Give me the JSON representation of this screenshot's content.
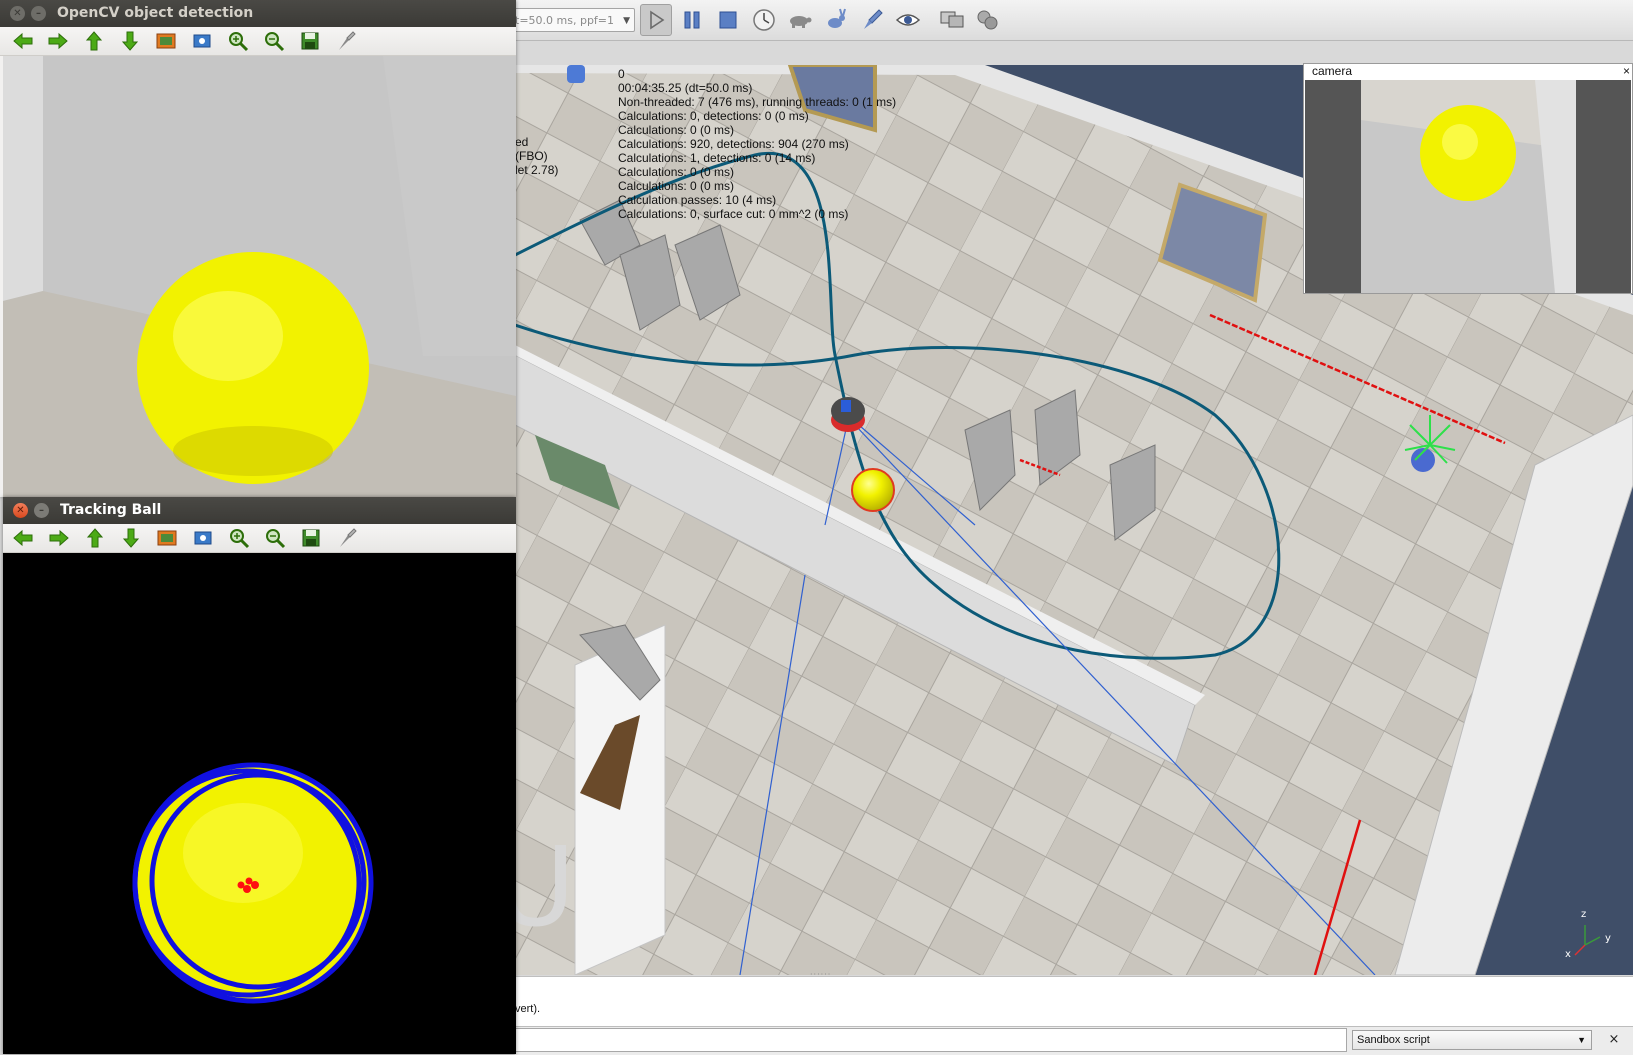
{
  "simulator": {
    "sim_settings_value": "t=50.0 ms, ppf=1",
    "toolbar_icons": [
      "play-icon",
      "pause-icon",
      "stop-icon",
      "real-time-icon",
      "turtle-icon",
      "rabbit-icon",
      "rocket-icon",
      "eye-icon",
      "monitor-icon",
      "camera-gear-icon"
    ],
    "info_lines": [
      "0",
      "00:04:35.25 (dt=50.0 ms)",
      "Non-threaded: 7 (476 ms), running threads: 0 (1 ms)",
      "Calculations: 0, detections: 0 (0 ms)",
      "Calculations: 0 (0 ms)",
      "Calculations: 920, detections: 904 (270 ms)",
      "Calculations: 1, detections: 0 (14 ms)",
      "Calculations: 0 (0 ms)",
      "Calculations: 0 (0 ms)",
      "Calculation passes: 10 (4 ms)",
      "Calculations: 0, surface cut: 0 mm^2 (0 ms)"
    ],
    "info_left_lines": [
      "ed",
      "(FBO)",
      "",
      "let 2.78)"
    ],
    "floating_view_title": "camera",
    "floating_view_close": "×",
    "console_text": "vert).",
    "script_selector": "Sandbox script",
    "script_clear": "×",
    "axes": {
      "z": "z",
      "y": "y",
      "x": "x"
    },
    "watermark_letter": "U"
  },
  "opencv_window": {
    "title": "OpenCV object detection",
    "state": "inactive"
  },
  "tracking_window": {
    "title": "Tracking Ball",
    "state": "active",
    "circle_color": "#1010e0",
    "center_color": "#ff1010"
  },
  "hg_toolbar": {
    "tools": [
      "pan-left-icon",
      "pan-right-icon",
      "pan-up-icon",
      "pan-down-icon",
      "zoom-fit-icon",
      "zoom-100-icon",
      "zoom-in-icon",
      "zoom-out-icon",
      "save-icon",
      "properties-icon"
    ]
  },
  "colors": {
    "ball": "#f2f200",
    "trajectory": "#0c5a78",
    "laser": "#3060d0",
    "titlebar": "#3c3b37"
  }
}
